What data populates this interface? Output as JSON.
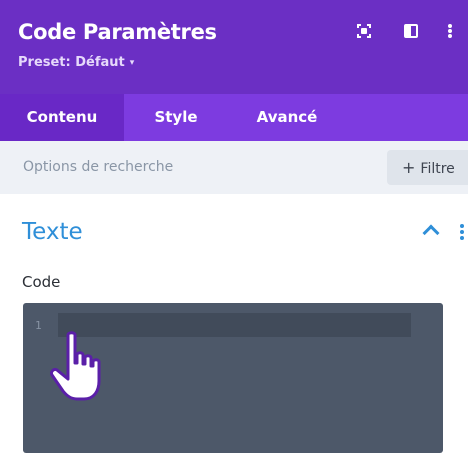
{
  "header": {
    "title": "Code Paramètres",
    "preset_label": "Preset: Défaut",
    "preset_caret": "▾",
    "icons": [
      "fullscreen-icon",
      "split-view-icon",
      "more-options-icon"
    ],
    "background": "#6b2fc4"
  },
  "tabs": [
    {
      "label": "Contenu",
      "active": true
    },
    {
      "label": "Style",
      "active": false
    },
    {
      "label": "Avancé",
      "active": false
    }
  ],
  "search": {
    "placeholder": "Options de recherche",
    "filter_plus": "+",
    "filter_label": "Filtre"
  },
  "section": {
    "title": "Texte",
    "accent": "#2f8fd8"
  },
  "field": {
    "label": "Code",
    "line_number": "1",
    "value": ""
  },
  "cursor": {
    "icon": "hand-pointer-icon"
  }
}
